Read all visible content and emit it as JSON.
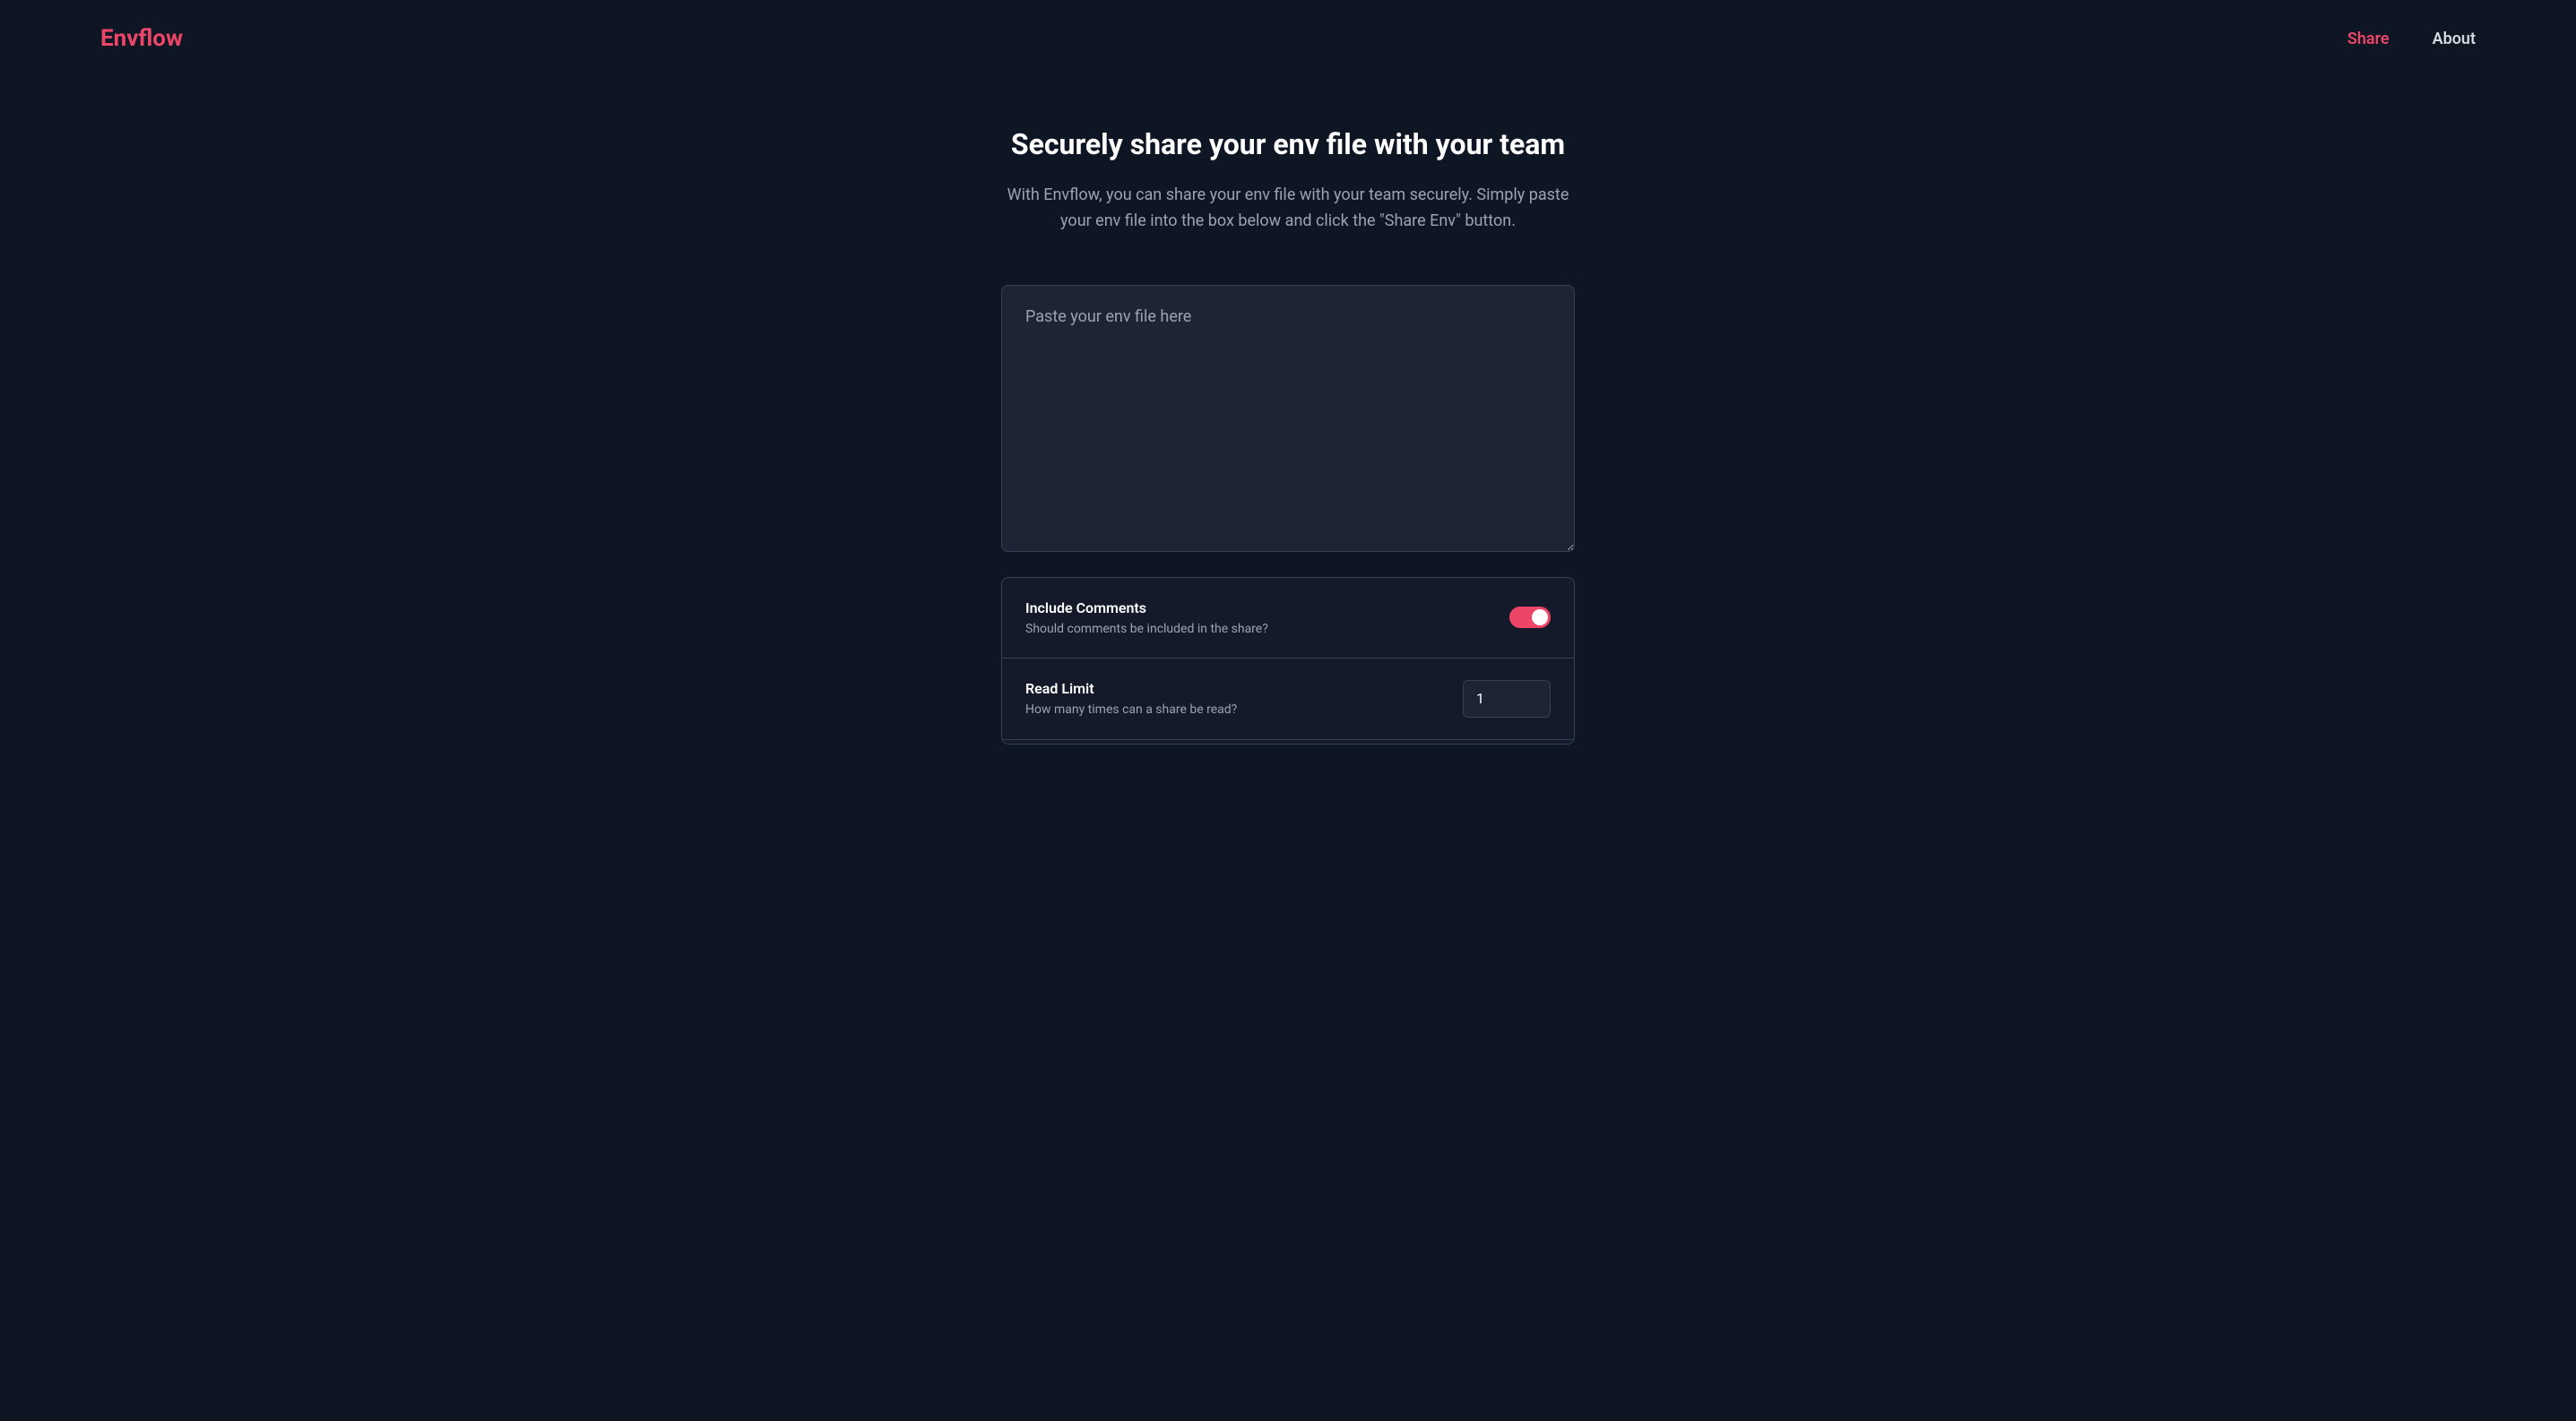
{
  "header": {
    "logo": "Envflow",
    "nav": {
      "share": "Share",
      "about": "About"
    }
  },
  "main": {
    "title": "Securely share your env file with your team",
    "subtitle": "With Envflow, you can share your env file with your team securely. Simply paste your env file into the box below and click the \"Share Env\" button.",
    "textarea_placeholder": "Paste your env file here"
  },
  "options": {
    "include_comments": {
      "label": "Include Comments",
      "description": "Should comments be included in the share?",
      "value": true
    },
    "read_limit": {
      "label": "Read Limit",
      "description": "How many times can a share be read?",
      "value": "1"
    }
  }
}
